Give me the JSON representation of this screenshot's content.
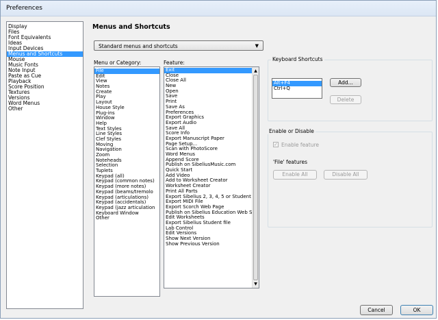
{
  "window": {
    "title": "Preferences"
  },
  "categories": {
    "items": [
      "Display",
      "Files",
      "Font Equivalents",
      "Ideas",
      "Input Devices",
      "Menus and Shortcuts",
      "Mouse",
      "Music Fonts",
      "Note Input",
      "Paste as Cue",
      "Playback",
      "Score Position",
      "Textures",
      "Versions",
      "Word Menus",
      "Other"
    ],
    "selected_index": 5
  },
  "page": {
    "heading": "Menus and Shortcuts"
  },
  "shortcut_set": {
    "value": "Standard menus and shortcuts"
  },
  "menu_category": {
    "label": "Menu or Category:",
    "items": [
      "File",
      "Edit",
      "View",
      "Notes",
      "Create",
      "Play",
      "Layout",
      "House Style",
      "Plug-ins",
      "Window",
      "Help",
      "Text Styles",
      "Line Styles",
      "Clef Styles",
      "Moving",
      "Navigation",
      "Zoom",
      "Noteheads",
      "Selection",
      "Tuplets",
      "Keypad (all)",
      "Keypad (common notes)",
      "Keypad (more notes)",
      "Keypad (beams/tremolo",
      "Keypad (articulations)",
      "Keypad (accidentals)",
      "Keypad (jazz articulation",
      "Keyboard Window",
      "Other"
    ],
    "selected_index": 0
  },
  "feature": {
    "label": "Feature:",
    "items": [
      "Exit",
      "Close",
      "Close All",
      "New",
      "Open",
      "Save",
      "Print",
      "Save As",
      "Preferences",
      "Export Graphics",
      "Export Audio",
      "Save All",
      "Score Info",
      "Export Manuscript Paper",
      "Page Setup...",
      "Scan with PhotoScore",
      "Word Menus",
      "Append Score",
      "Publish on SibeliusMusic.com",
      "Quick Start",
      "Add Video",
      "Add to Worksheet Creator",
      "Worksheet Creator",
      "Print All Parts",
      "Export Sibelius 2, 3, 4, 5 or Student",
      "Export MIDI File",
      "Export Scorch Web Page",
      "Publish on Sibelius Education Web Si",
      "Edit Worksheets",
      "Export Sibelius Student file",
      "Lab Control",
      "Edit Versions",
      "Show Next Version",
      "Show Previous Version"
    ],
    "selected_index": 0
  },
  "keyboard_shortcuts": {
    "label": "Keyboard Shortcuts",
    "items": [
      "Alt+F4",
      "Ctrl+Q"
    ],
    "selected_index": 0,
    "add_label": "Add...",
    "delete_label": "Delete"
  },
  "enable_disable": {
    "label": "Enable or Disable",
    "checkbox_label": "Enable feature",
    "checked": true,
    "features_label": "'File' features",
    "enable_all_label": "Enable All",
    "disable_all_label": "Disable All"
  },
  "footer": {
    "cancel_label": "Cancel",
    "ok_label": "OK"
  }
}
